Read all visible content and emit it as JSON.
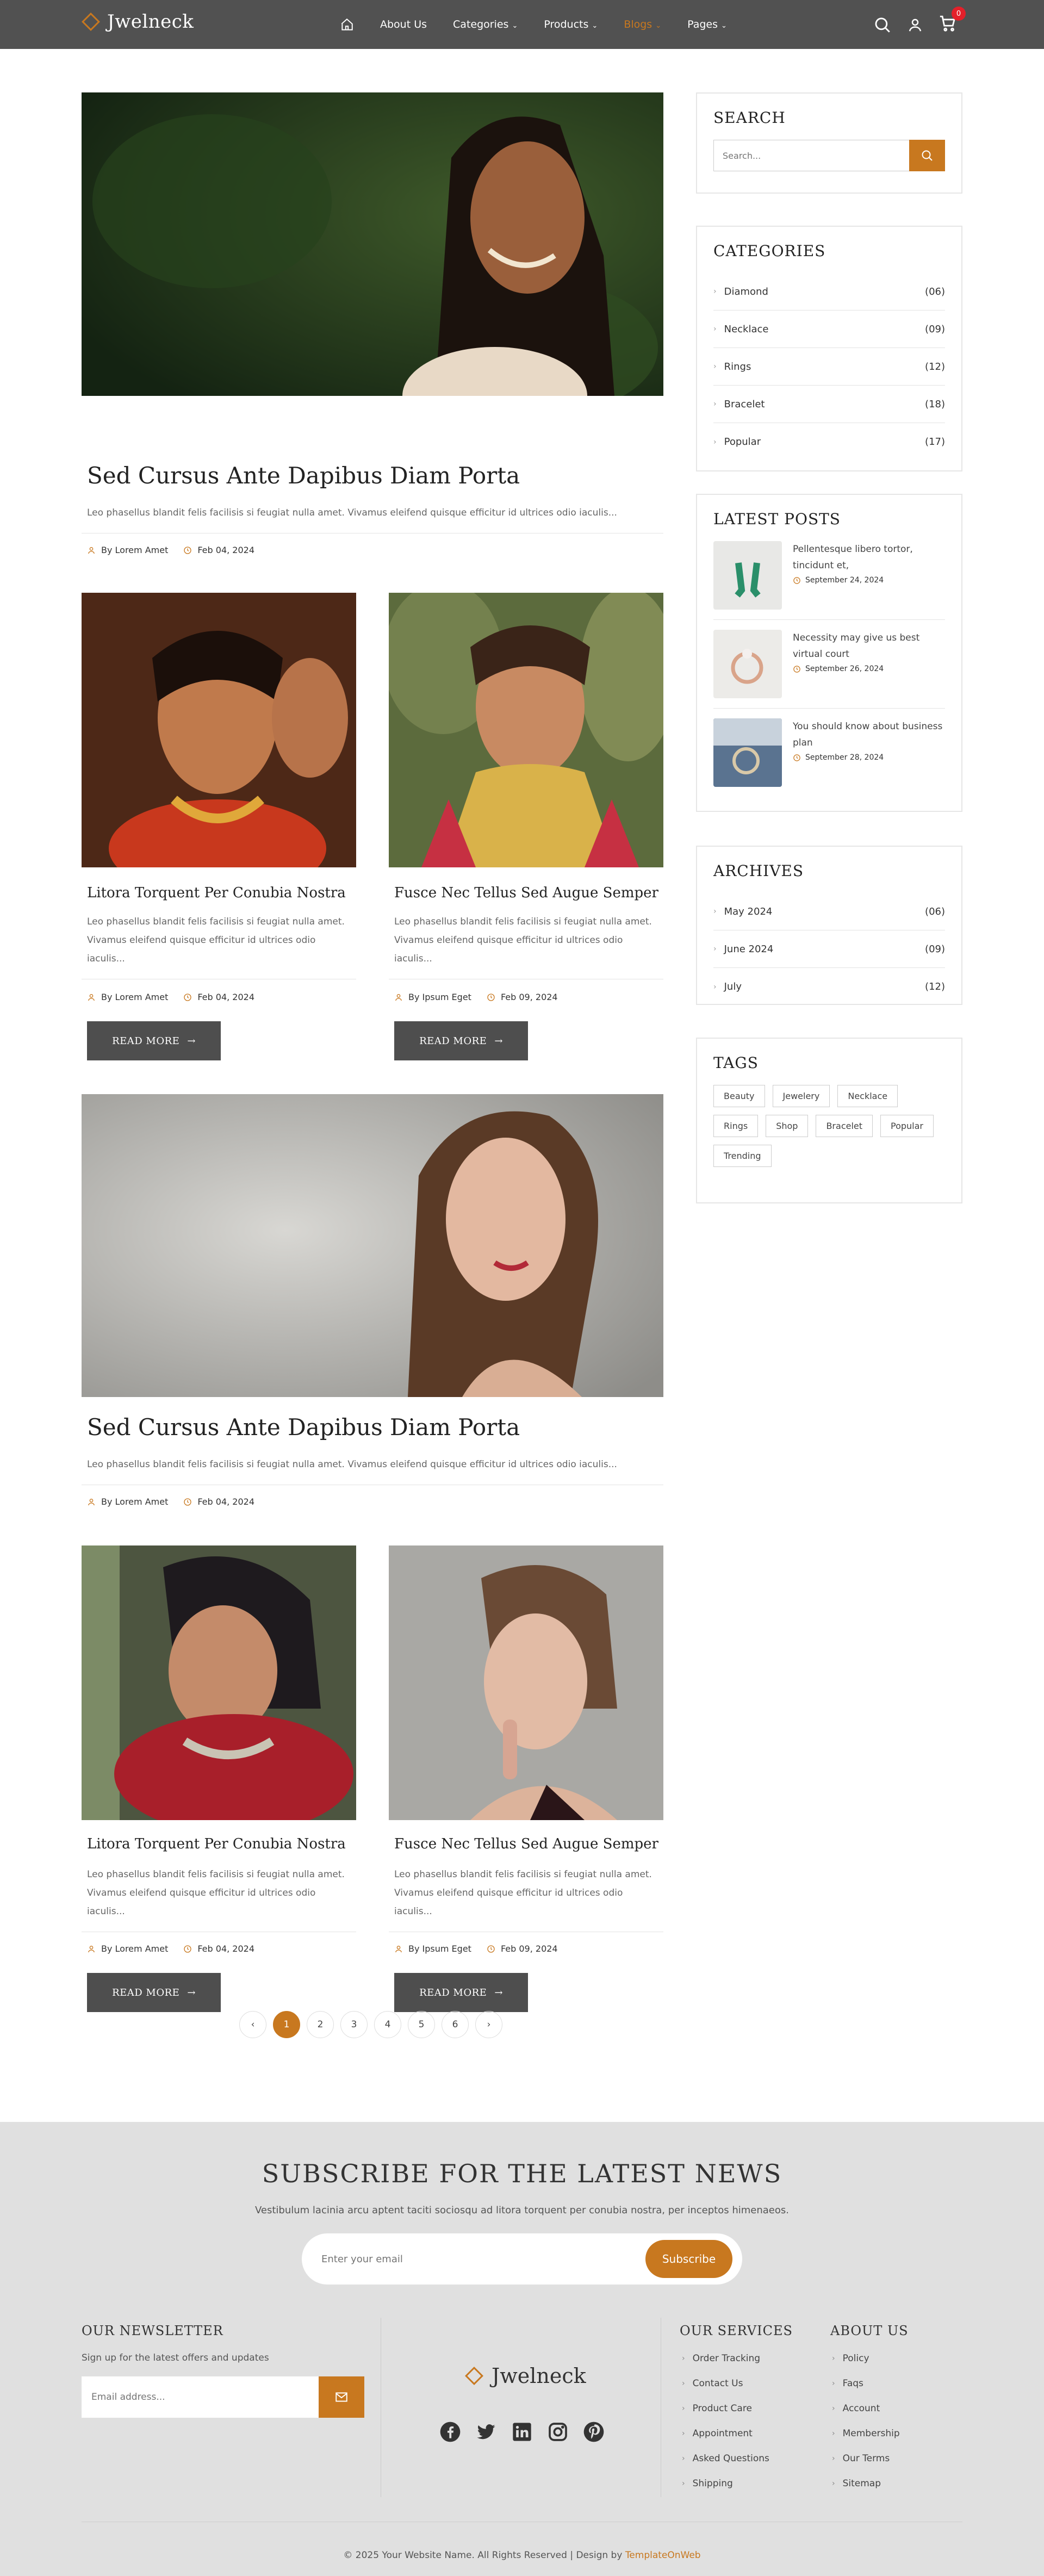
{
  "header": {
    "brand": "Jwelneck",
    "nav": [
      {
        "label": "About Us",
        "has_caret": false
      },
      {
        "label": "Categories",
        "has_caret": true
      },
      {
        "label": "Products",
        "has_caret": true
      },
      {
        "label": "Blogs",
        "has_caret": true,
        "active": true
      },
      {
        "label": "Pages",
        "has_caret": true
      }
    ],
    "cart_count": "0"
  },
  "posts": [
    {
      "title": "Sed Cursus Ante Dapibus Diam Porta",
      "excerpt": "Leo phasellus blandit felis facilisis si feugiat nulla amet. Vivamus eleifend quisque efficitur id ultrices odio iaculis...",
      "author": "By Lorem Amet",
      "date": "Feb 04, 2024"
    },
    {
      "title": "Litora Torquent Per Conubia Nostra",
      "excerpt": "Leo phasellus blandit felis facilisis si feugiat nulla amet. Vivamus eleifend quisque efficitur id ultrices odio iaculis...",
      "author": "By Lorem Amet",
      "date": "Feb 04, 2024",
      "button": "READ MORE"
    },
    {
      "title": "Fusce Nec Tellus Sed Augue Semper",
      "excerpt": "Leo phasellus blandit felis facilisis si feugiat nulla amet. Vivamus eleifend quisque efficitur id ultrices odio iaculis...",
      "author": "By Ipsum Eget",
      "date": "Feb 09, 2024",
      "button": "READ MORE"
    },
    {
      "title": "Sed Cursus Ante Dapibus Diam Porta",
      "excerpt": "Leo phasellus blandit felis facilisis si feugiat nulla amet. Vivamus eleifend quisque efficitur id ultrices odio iaculis...",
      "author": "By Lorem Amet",
      "date": "Feb 04, 2024"
    },
    {
      "title": "Litora Torquent Per Conubia Nostra",
      "excerpt": "Leo phasellus blandit felis facilisis si feugiat nulla amet. Vivamus eleifend quisque efficitur id ultrices odio iaculis...",
      "author": "By Lorem Amet",
      "date": "Feb 04, 2024",
      "button": "READ MORE"
    },
    {
      "title": "Fusce Nec Tellus Sed Augue Semper",
      "excerpt": "Leo phasellus blandit felis facilisis si feugiat nulla amet. Vivamus eleifend quisque efficitur id ultrices odio iaculis...",
      "author": "By Ipsum Eget",
      "date": "Feb 09, 2024",
      "button": "READ MORE"
    }
  ],
  "pagination": [
    "1",
    "2",
    "3",
    "4",
    "5",
    "6"
  ],
  "sidebar": {
    "search": {
      "title": "SEARCH",
      "placeholder": "Search..."
    },
    "categories": {
      "title": "CATEGORIES",
      "items": [
        {
          "label": "Diamond",
          "count": "(06)"
        },
        {
          "label": "Necklace",
          "count": "(09)"
        },
        {
          "label": "Rings",
          "count": "(12)"
        },
        {
          "label": "Bracelet",
          "count": "(18)"
        },
        {
          "label": "Popular",
          "count": "(17)"
        }
      ]
    },
    "latest": {
      "title": "LATEST POSTS",
      "items": [
        {
          "title": "Pellentesque libero tortor, tincidunt et,",
          "date": "September 24, 2024"
        },
        {
          "title": "Necessity may give us best virtual court",
          "date": "September 26, 2024"
        },
        {
          "title": "You should know about business plan",
          "date": "September 28, 2024"
        }
      ]
    },
    "archives": {
      "title": "ARCHIVES",
      "items": [
        {
          "label": "May 2024",
          "count": "(06)"
        },
        {
          "label": "June 2024",
          "count": "(09)"
        },
        {
          "label": "July",
          "count": "(12)"
        }
      ]
    },
    "tags": {
      "title": "TAGS",
      "items": [
        "Beauty",
        "Jewelery",
        "Necklace",
        "Rings",
        "Shop",
        "Bracelet",
        "Popular",
        "Trending"
      ]
    }
  },
  "subscribe": {
    "title": "SUBSCRIBE FOR THE LATEST NEWS",
    "desc": "Vestibulum lacinia arcu aptent taciti sociosqu ad litora torquent per conubia nostra, per inceptos himenaeos.",
    "placeholder": "Enter your email",
    "button": "Subscribe"
  },
  "footer": {
    "newsletter": {
      "title": "OUR NEWSLETTER",
      "text": "Sign up for the latest offers and updates",
      "placeholder": "Email address..."
    },
    "brand": "Jwelneck",
    "services": {
      "title": "OUR SERVICES",
      "items": [
        "Order Tracking",
        "Contact Us",
        "Product Care",
        "Appointment",
        "Asked Questions",
        "Shipping"
      ]
    },
    "about": {
      "title": "ABOUT US",
      "items": [
        "Policy",
        "Faqs",
        "Account",
        "Membership",
        "Our Terms",
        "Sitemap"
      ]
    },
    "copyright": "© 2025 Your Website Name. All Rights Reserved | Design by ",
    "designer": "TemplateOnWeb"
  },
  "colors": {
    "accent": "#c8781f",
    "header_bg": "#515151",
    "button_bg": "#4e4e4e",
    "footer_bg": "#e0e0e0"
  }
}
